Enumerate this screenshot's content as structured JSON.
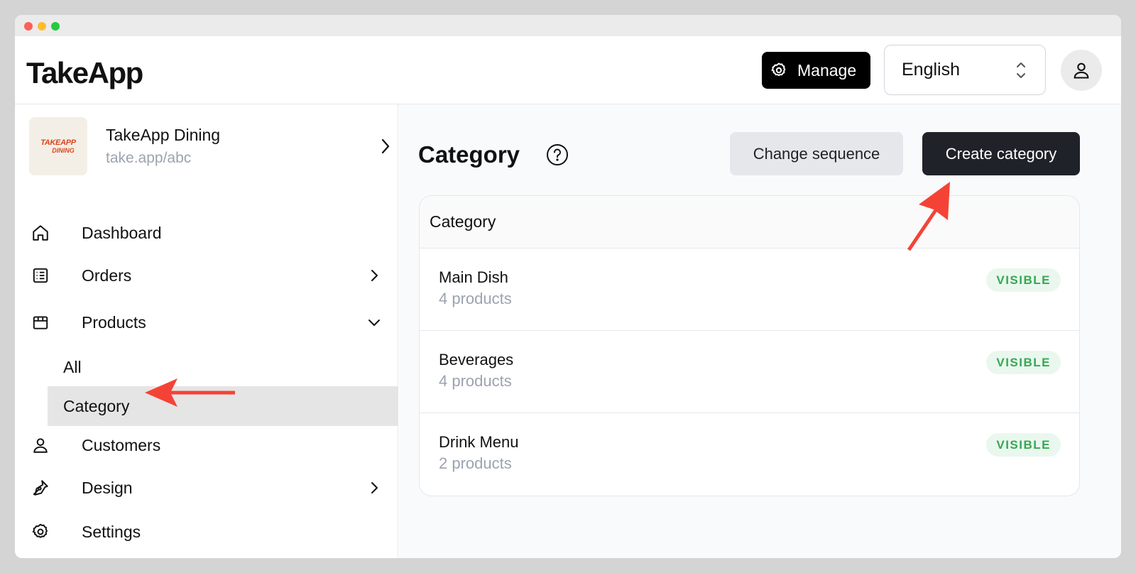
{
  "app": {
    "logo": "TakeApp",
    "manage_label": "Manage",
    "language": "English"
  },
  "store": {
    "name": "TakeApp Dining",
    "url": "take.app/abc",
    "logo_text_1": "TAKEAPP",
    "logo_text_2": "DINING"
  },
  "nav": {
    "dashboard": "Dashboard",
    "orders": "Orders",
    "products": "Products",
    "products_sub": {
      "all": "All",
      "category": "Category"
    },
    "customers": "Customers",
    "design": "Design",
    "settings": "Settings"
  },
  "main": {
    "title": "Category",
    "change_sequence": "Change sequence",
    "create_category": "Create category",
    "table_header": "Category",
    "rows": [
      {
        "name": "Main Dish",
        "count": "4 products",
        "status": "VISIBLE"
      },
      {
        "name": "Beverages",
        "count": "4 products",
        "status": "VISIBLE"
      },
      {
        "name": "Drink Menu",
        "count": "2 products",
        "status": "VISIBLE"
      }
    ]
  },
  "colors": {
    "annotation_arrow": "#f44336",
    "status_visible": "#34a853",
    "primary_button": "#1f2329"
  }
}
